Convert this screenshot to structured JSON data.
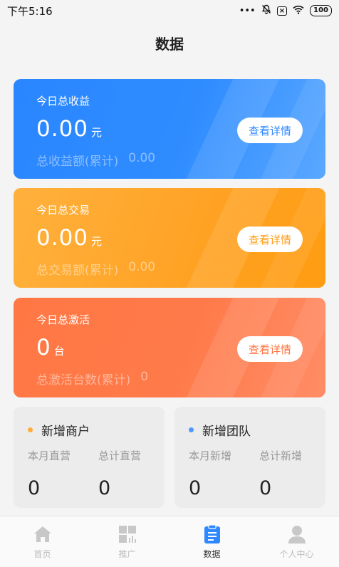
{
  "status_bar": {
    "time": "下午5:16",
    "battery": "100",
    "more": "•••"
  },
  "page": {
    "title": "数据"
  },
  "cards": [
    {
      "label": "今日总收益",
      "value": "0.00",
      "unit": "元",
      "total_label": "总收益额(累计)",
      "total_value": "0.00",
      "button": "查看详情"
    },
    {
      "label": "今日总交易",
      "value": "0.00",
      "unit": "元",
      "total_label": "总交易额(累计)",
      "total_value": "0.00",
      "button": "查看详情"
    },
    {
      "label": "今日总激活",
      "value": "0",
      "unit": "台",
      "total_label": "总激活台数(累计)",
      "total_value": "0",
      "button": "查看详情"
    }
  ],
  "stats": {
    "merchants": {
      "title": "新增商户",
      "col1_label": "本月直营",
      "col1_value": "0",
      "col2_label": "总计直营",
      "col2_value": "0"
    },
    "team": {
      "title": "新增团队",
      "col1_label": "本月新增",
      "col1_value": "0",
      "col2_label": "总计新增",
      "col2_value": "0"
    }
  },
  "tabbar": [
    {
      "label": "首页",
      "icon": "home-icon"
    },
    {
      "label": "推广",
      "icon": "grid-icon"
    },
    {
      "label": "数据",
      "icon": "clipboard-icon"
    },
    {
      "label": "个人中心",
      "icon": "user-icon"
    }
  ],
  "colors": {
    "blue": "#2f88ff",
    "orange": "#ffa326",
    "red": "#ff7a4a"
  }
}
